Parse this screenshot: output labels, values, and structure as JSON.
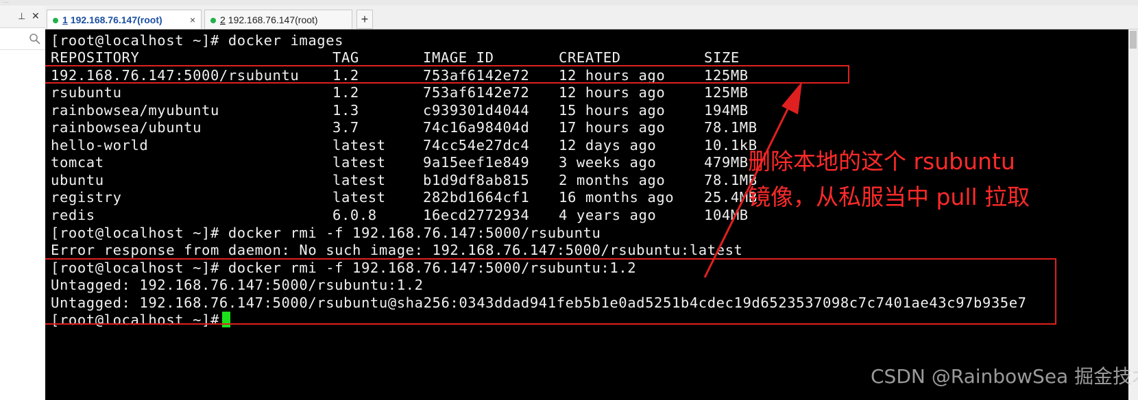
{
  "window": {
    "top_strip_text": "...."
  },
  "sidebar": {
    "pin_icon": "pin-icon",
    "close_label": "✕",
    "search_icon": "search-icon"
  },
  "tabs": [
    {
      "num": "1",
      "label": "192.168.76.147(root)",
      "close": "×",
      "active": true,
      "status_color": "#22b14c"
    },
    {
      "num": "2",
      "label": "192.168.76.147(root)",
      "active": false,
      "status_color": "#22b14c"
    }
  ],
  "add_tab_label": "+",
  "terminal": {
    "prompt": "[root@localhost ~]#",
    "cmd1": "docker images",
    "headers": [
      "REPOSITORY",
      "TAG",
      "IMAGE ID",
      "CREATED",
      "SIZE"
    ],
    "rows": [
      [
        "192.168.76.147:5000/rsubuntu",
        "1.2",
        "753af6142e72",
        "12 hours ago",
        "125MB"
      ],
      [
        "rsubuntu",
        "1.2",
        "753af6142e72",
        "12 hours ago",
        "125MB"
      ],
      [
        "rainbowsea/myubuntu",
        "1.3",
        "c939301d4044",
        "15 hours ago",
        "194MB"
      ],
      [
        "rainbowsea/ubuntu",
        "3.7",
        "74c16a98404d",
        "17 hours ago",
        "78.1MB"
      ],
      [
        "hello-world",
        "latest",
        "74cc54e27dc4",
        "12 days ago",
        "10.1kB"
      ],
      [
        "tomcat",
        "latest",
        "9a15eef1e849",
        "3 weeks ago",
        "479MB"
      ],
      [
        "ubuntu",
        "latest",
        "b1d9df8ab815",
        "2 months ago",
        "78.1MB"
      ],
      [
        "registry",
        "latest",
        "282bd1664cf1",
        "16 months ago",
        "25.4MB"
      ],
      [
        "redis",
        "6.0.8",
        "16ecd2772934",
        "4 years ago",
        "104MB"
      ]
    ],
    "cmd2": "docker rmi -f 192.168.76.147:5000/rsubuntu",
    "error": "Error response from daemon: No such image: 192.168.76.147:5000/rsubuntu:latest",
    "cmd3": "docker rmi -f 192.168.76.147:5000/rsubuntu:1.2",
    "untag1": "Untagged: 192.168.76.147:5000/rsubuntu:1.2",
    "untag2": "Untagged: 192.168.76.147:5000/rsubuntu@sha256:0343ddad941feb5b1e0ad5251b4cdec19d6523537098c7c7401ae43c97b935e7"
  },
  "annotation": {
    "line1": "删除本地的这个 rsubuntu",
    "line2": "镜像，从私服当中 pull 拉取",
    "color": "#ff2a2a"
  },
  "watermark": "CSDN @RainbowSea 掘金技术社区"
}
